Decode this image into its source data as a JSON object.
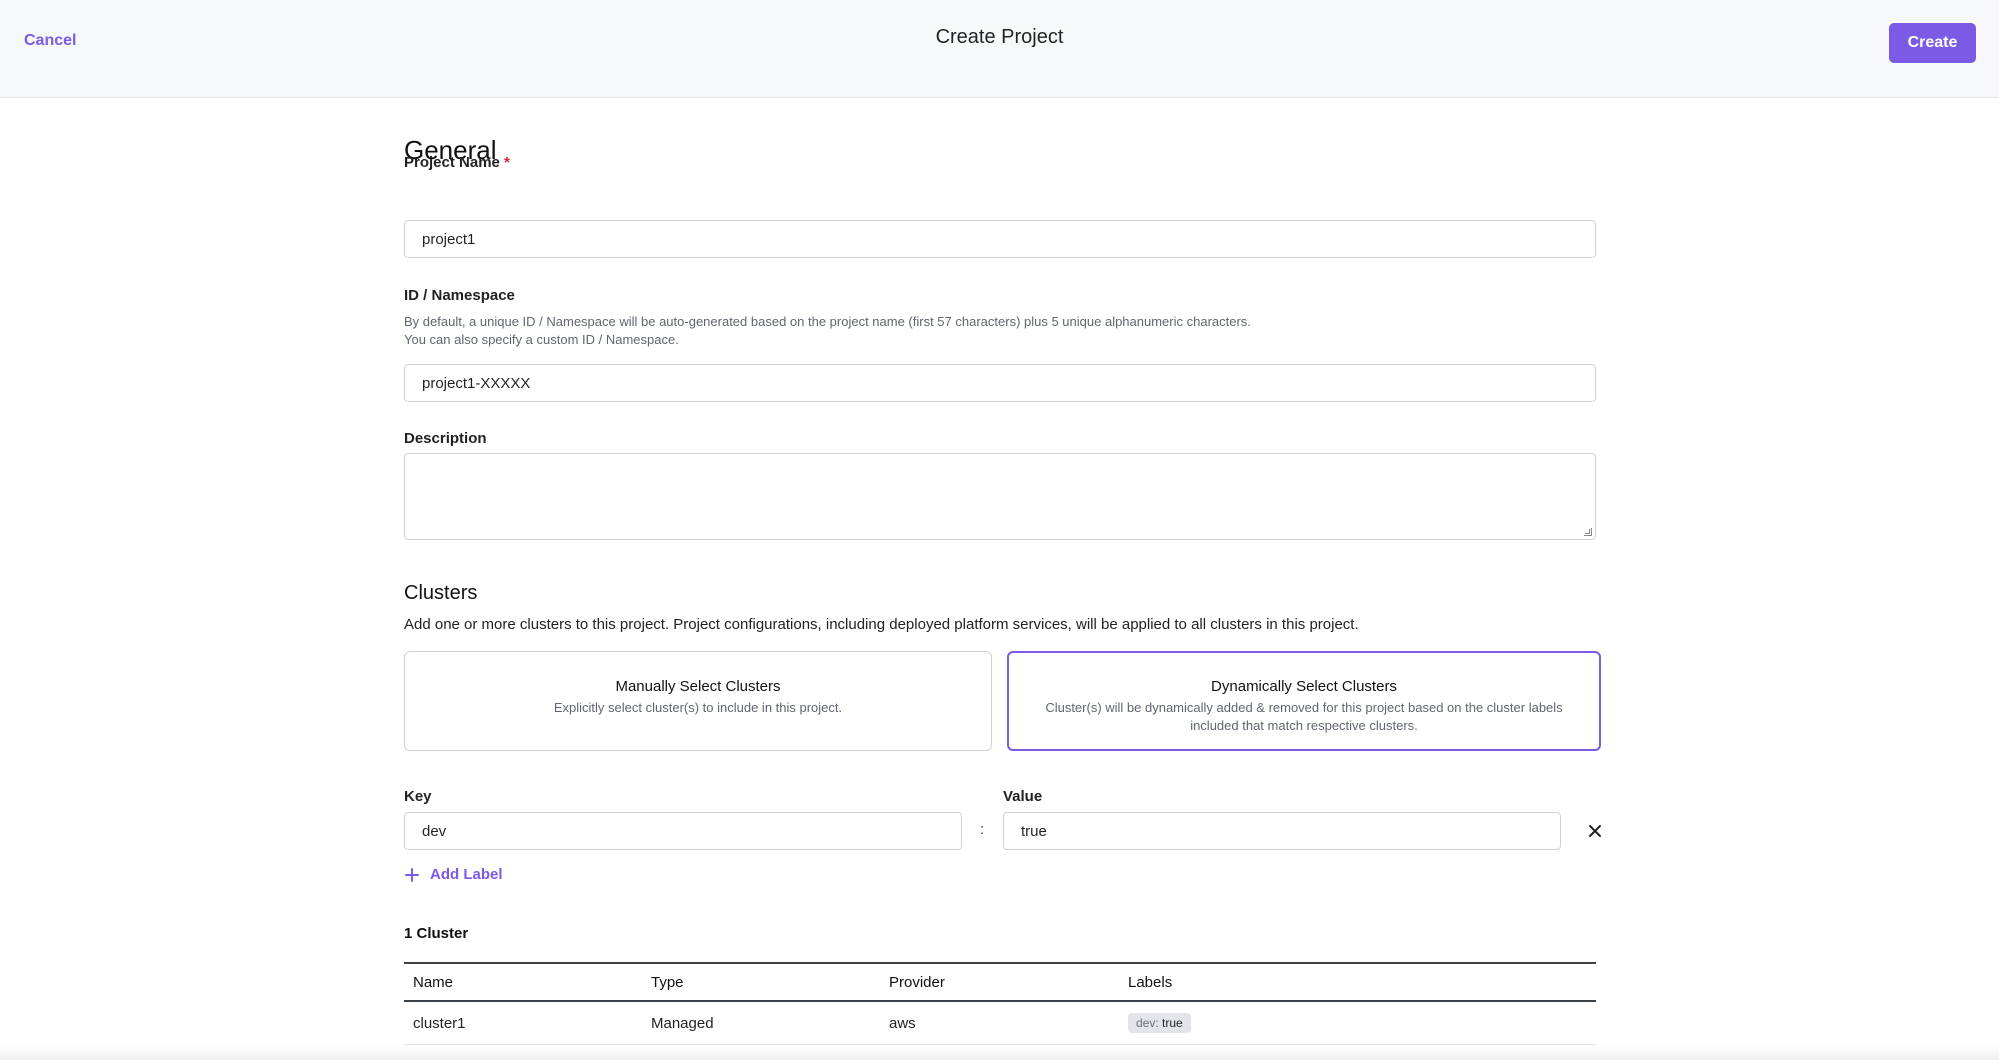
{
  "header": {
    "cancel_label": "Cancel",
    "title": "Create Project",
    "create_label": "Create"
  },
  "general": {
    "heading": "General",
    "project_name": {
      "label": "Project Name",
      "required_mark": "*",
      "value": "project1"
    },
    "namespace": {
      "label": "ID / Namespace",
      "help_line1": "By default, a unique ID / Namespace will be auto-generated based on the project name (first 57 characters) plus 5 unique alphanumeric characters.",
      "help_line2": "You can also specify a custom ID / Namespace.",
      "value": "project1-XXXXX"
    },
    "description": {
      "label": "Description",
      "value": ""
    }
  },
  "clusters": {
    "heading": "Clusters",
    "description": "Add one or more clusters to this project. Project configurations, including deployed platform services, will be applied to all clusters in this project.",
    "options": [
      {
        "title": "Manually Select Clusters",
        "subtitle": "Explicitly select cluster(s) to include in this project.",
        "selected": false
      },
      {
        "title": "Dynamically Select Clusters",
        "subtitle": "Cluster(s) will be dynamically added & removed for this project based on the cluster labels included that match respective clusters.",
        "selected": true
      }
    ],
    "label_selector": {
      "key_label": "Key",
      "value_label": "Value",
      "separator": ":",
      "key_value": "dev",
      "value_value": "true",
      "remove_icon": "close-icon"
    },
    "add_label": "Add Label",
    "count_label": "1 Cluster",
    "table": {
      "columns": [
        "Name",
        "Type",
        "Provider",
        "Labels"
      ],
      "rows": [
        {
          "name": "cluster1",
          "type": "Managed",
          "provider": "aws",
          "label_key": "dev:",
          "label_value": "true"
        }
      ]
    }
  },
  "colors": {
    "accent": "#7b5ae6",
    "header_bg": "#f7f8fa",
    "required": "#d1242f"
  }
}
